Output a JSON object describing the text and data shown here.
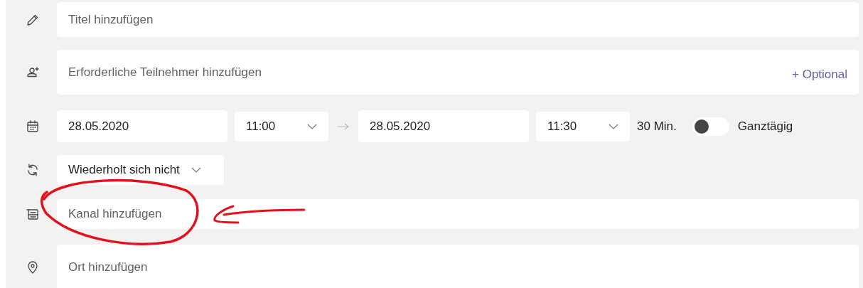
{
  "title_field": {
    "placeholder": "Titel hinzufügen"
  },
  "attendees_field": {
    "placeholder": "Erforderliche Teilnehmer hinzufügen",
    "optional_link": "+ Optional"
  },
  "schedule": {
    "start_date": "28.05.2020",
    "start_time": "11:00",
    "end_date": "28.05.2020",
    "end_time": "11:30",
    "duration": "30 Min.",
    "all_day": {
      "label": "Ganztägig",
      "on": false
    }
  },
  "repeat": {
    "value": "Wiederholt sich nicht"
  },
  "channel_field": {
    "placeholder": "Kanal hinzufügen"
  },
  "location_field": {
    "placeholder": "Ort hinzufügen"
  }
}
